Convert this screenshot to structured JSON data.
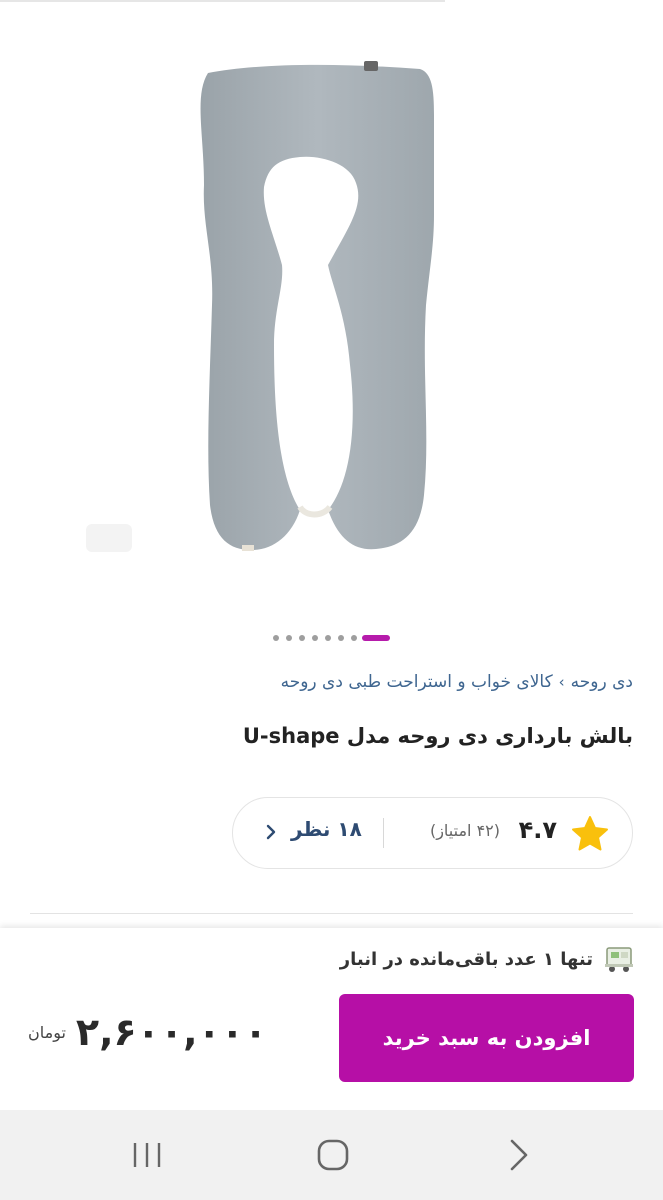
{
  "product": {
    "image_alt": "pillow-image",
    "breadcrumb": [
      "دی روحه",
      "کالای خواب و استراحت طبی دی روحه"
    ],
    "title": "بالش بارداری دی روحه مدل U-shape"
  },
  "carousel": {
    "total": 8,
    "active_index": 7
  },
  "rating": {
    "score": "۴.۷",
    "count": "(۴۲ امتیاز)",
    "reviews": "۱۸ نظر",
    "star_color": "#f9c00c"
  },
  "buy_bar": {
    "stock": "تنها ۱ عدد باقی‌مانده در انبار",
    "button": "افزودن به سبد خرید",
    "price": "۲,۶۰۰,۰۰۰",
    "unit": "تومان",
    "accent": "#b60fa6"
  },
  "nav": {
    "recent": "recent-apps-icon",
    "home": "home-icon",
    "back": "back-icon"
  }
}
